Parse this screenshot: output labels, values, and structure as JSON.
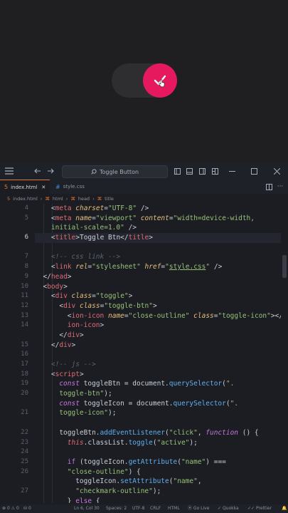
{
  "colors": {
    "accent": "#e6195f",
    "toggle_track": "#2e2e31"
  },
  "preview": {
    "toggle_icon": "checkmark-icon",
    "cursor": "hand-pointer-icon"
  },
  "titlebar": {
    "search_text": "Toggle Button"
  },
  "tabs": [
    {
      "label": "index.html",
      "active": true
    },
    {
      "label": "style.css",
      "active": false
    }
  ],
  "breadcrumb": [
    "index.html",
    "html",
    "head",
    "title"
  ],
  "code": {
    "line_numbers": [
      "4",
      "5",
      "",
      "6",
      "",
      "7",
      "8",
      "9",
      "10",
      "11",
      "12",
      "13",
      "14",
      "",
      "15",
      "16",
      "17",
      "18",
      "19",
      "20",
      "",
      "21",
      "",
      "22",
      "23",
      "24",
      "25",
      "26",
      "",
      "27",
      "",
      "28"
    ],
    "current_line": "6"
  },
  "status": {
    "errors": "0",
    "warnings": "0",
    "port": "0",
    "position": "Ln 6, Col 30",
    "spaces": "Spaces: 2",
    "encoding": "UTF-8",
    "eol": "CRLF",
    "language": "HTML",
    "golive": "Go Live",
    "quokka": "Quokka",
    "prettier": "Prettier"
  }
}
